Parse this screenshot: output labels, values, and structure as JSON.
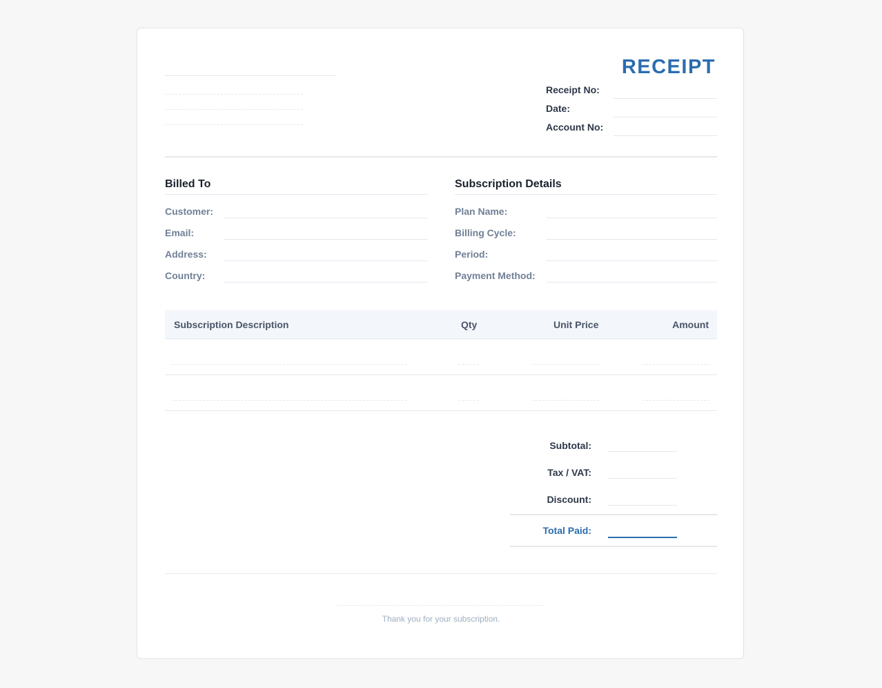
{
  "header": {
    "title": "RECEIPT",
    "meta": [
      {
        "label": "Receipt No:",
        "value": ""
      },
      {
        "label": "Date:",
        "value": ""
      },
      {
        "label": "Account No:",
        "value": ""
      }
    ]
  },
  "billed_to": {
    "title": "Billed To",
    "fields": [
      {
        "label": "Customer:",
        "value": ""
      },
      {
        "label": "Email:",
        "value": ""
      },
      {
        "label": "Address:",
        "value": ""
      },
      {
        "label": "Country:",
        "value": ""
      }
    ]
  },
  "subscription": {
    "title": "Subscription Details",
    "fields": [
      {
        "label": "Plan Name:",
        "value": ""
      },
      {
        "label": "Billing Cycle:",
        "value": ""
      },
      {
        "label": "Period:",
        "value": ""
      },
      {
        "label": "Payment Method:",
        "value": ""
      }
    ]
  },
  "table": {
    "columns": [
      "Subscription Description",
      "Qty",
      "Unit Price",
      "Amount"
    ],
    "rows": [
      [
        "",
        "",
        "",
        ""
      ],
      [
        "",
        "",
        "",
        ""
      ]
    ]
  },
  "totals": {
    "subtotal_label": "Subtotal:",
    "tax_label": "Tax / VAT:",
    "discount_label": "Discount:",
    "total_label": "Total Paid:"
  },
  "footer": {
    "thanks": "Thank you for your subscription."
  },
  "colors": {
    "accent": "#2b6cb0",
    "background": "#f7f7f8",
    "border": "#e5e7eb"
  }
}
